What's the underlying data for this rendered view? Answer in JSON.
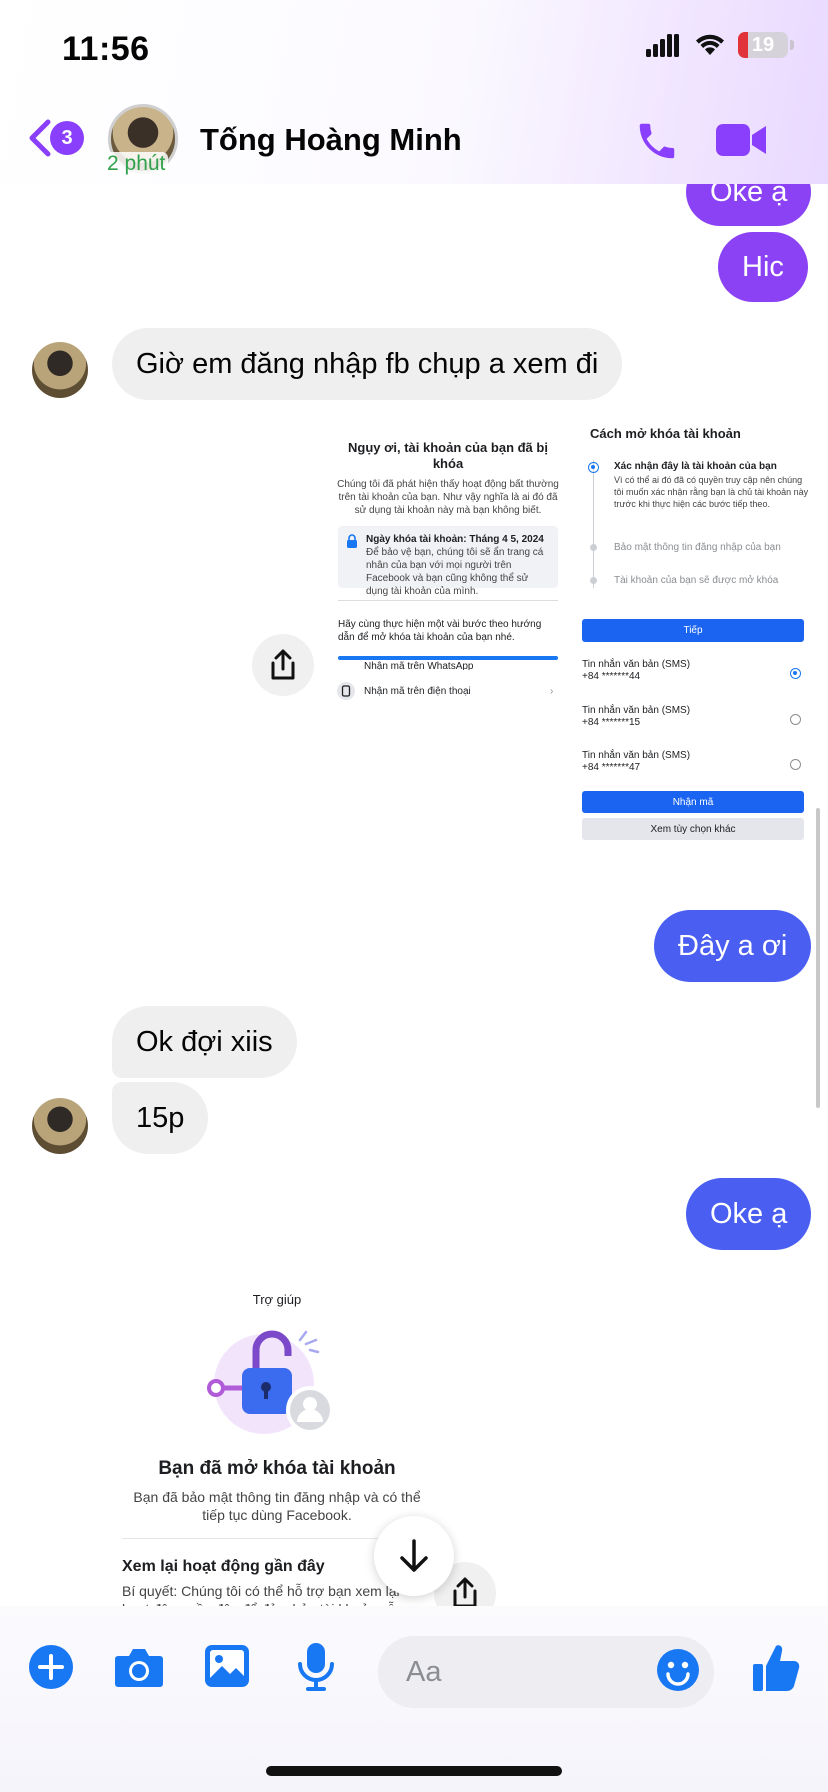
{
  "status_bar": {
    "time": "11:56",
    "battery": "19",
    "battery_level": 0.19
  },
  "header": {
    "back_count": "3",
    "contact_name": "Tống Hoàng Minh",
    "active_status": "2 phút"
  },
  "messages": [
    {
      "side": "out",
      "text": "Oke ạ"
    },
    {
      "side": "out",
      "text": "Hic"
    },
    {
      "side": "in",
      "text": "Giờ em đăng nhập fb chụp a xem đi"
    },
    {
      "side": "out",
      "text": "Đây a ơi"
    },
    {
      "side": "in",
      "text": "Ok đợi xiis"
    },
    {
      "side": "in",
      "text": "15p"
    },
    {
      "side": "out",
      "text": "Oke ạ"
    }
  ],
  "shared_image_1": {
    "left": {
      "title": "Ngụy ơi, tài khoản của bạn đã bị khóa",
      "body": "Chúng tôi đã phát hiện thấy hoạt động bất thường trên tài khoản của bạn. Như vậy nghĩa là ai đó đã sử dụng tài khoản này mà bạn không biết.",
      "lock_title": "Ngày khóa tài khoản: Tháng 4 5, 2024",
      "lock_body": "Để bảo vệ bạn, chúng tôi sẽ ẩn trang cá nhân của bạn với mọi người trên Facebook và bạn cũng không thể sử dụng tài khoản của mình.",
      "steps_intro": "Hãy cùng thực hiện một vài bước theo hướng dẫn để mở khóa tài khoản của bạn nhé.",
      "option_whatsapp": "Nhận mã trên WhatsApp",
      "option_phone": "Nhận mã trên điện thoại"
    },
    "right": {
      "title": "Cách mở khóa tài khoản",
      "step1_title": "Xác nhận đây là tài khoản của bạn",
      "step1_body": "Vì có thể ai đó đã có quyền truy cập nên chúng tôi muốn xác nhận rằng bạn là chủ tài khoản này trước khi thực hiện các bước tiếp theo.",
      "step2": "Bảo mật thông tin đăng nhập của bạn",
      "step3": "Tài khoản của bạn sẽ được mở khóa",
      "continue_button": "Tiếp",
      "sms_label": "Tin nhắn văn bản (SMS)",
      "sms_numbers": [
        "+84 *******44",
        "+84 *******15",
        "+84 *******47"
      ],
      "get_code_button": "Nhận mã",
      "more_options_button": "Xem tùy chọn khác"
    }
  },
  "shared_image_2": {
    "help_label": "Trợ giúp",
    "title": "Bạn đã mở khóa tài khoản",
    "body": "Bạn đã bảo mật thông tin đăng nhập và có thể tiếp tục dùng Facebook.",
    "section_title": "Xem lại hoạt động gần đây",
    "section_body": "Bí quyết: Chúng tôi có thể hỗ trợ bạn xem lại hoạt động gần đây để đảm bảo tài khoản vẫn"
  },
  "composer": {
    "placeholder": "Aa"
  },
  "colors": {
    "accent_purple": "#8b42f5",
    "accent_blue": "#4a5ff2",
    "icon_blue": "#1877f2",
    "incoming_bubble": "#efefef"
  },
  "icons": [
    "back-chevron-icon",
    "phone-icon",
    "video-camera-icon",
    "share-icon",
    "arrow-down-icon",
    "plus-icon",
    "camera-icon",
    "gallery-icon",
    "microphone-icon",
    "emoji-icon",
    "thumbs-up-icon"
  ]
}
